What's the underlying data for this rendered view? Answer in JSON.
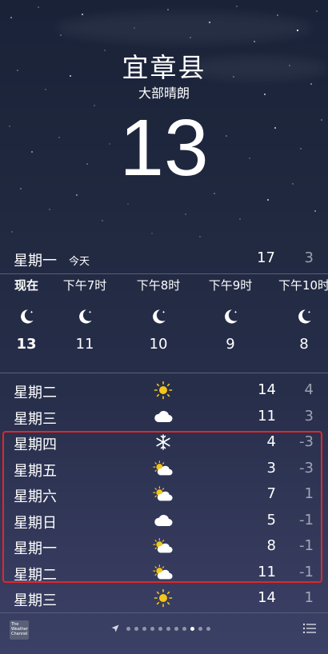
{
  "location": {
    "city": "宜章县",
    "condition": "大部晴朗",
    "temperature": "13"
  },
  "today": {
    "day": "星期一",
    "tag": "今天",
    "high": "17",
    "low": "3"
  },
  "hourly": [
    {
      "label": "现在",
      "icon": "moon-icon",
      "temp": "13"
    },
    {
      "label": "下午7时",
      "icon": "moon-icon",
      "temp": "11"
    },
    {
      "label": "下午8时",
      "icon": "moon-icon",
      "temp": "10"
    },
    {
      "label": "下午9时",
      "icon": "moon-icon",
      "temp": "9"
    },
    {
      "label": "下午10时",
      "icon": "moon-icon",
      "temp": "8"
    }
  ],
  "daily": [
    {
      "day": "星期二",
      "icon": "sun-icon",
      "high": "14",
      "low": "4"
    },
    {
      "day": "星期三",
      "icon": "cloud-icon",
      "high": "11",
      "low": "3"
    },
    {
      "day": "星期四",
      "icon": "snow-icon",
      "high": "4",
      "low": "-3"
    },
    {
      "day": "星期五",
      "icon": "partly-cloudy-icon",
      "high": "3",
      "low": "-3"
    },
    {
      "day": "星期六",
      "icon": "partly-cloudy-icon",
      "high": "7",
      "low": "1"
    },
    {
      "day": "星期日",
      "icon": "cloud-icon",
      "high": "5",
      "low": "-1"
    },
    {
      "day": "星期一",
      "icon": "partly-cloudy-icon",
      "high": "8",
      "low": "-1"
    },
    {
      "day": "星期二",
      "icon": "partly-cloudy-icon",
      "high": "11",
      "low": "-1"
    },
    {
      "day": "星期三",
      "icon": "sun-icon",
      "high": "14",
      "low": "1"
    }
  ],
  "footer": {
    "logo_text": "The Weather Channel",
    "page_count": 12,
    "active_page": 9
  },
  "colors": {
    "highlight": "#e2262b",
    "sun": "#f5c518",
    "bg_top": "#1a2238",
    "bg_bottom": "#3b4066"
  }
}
